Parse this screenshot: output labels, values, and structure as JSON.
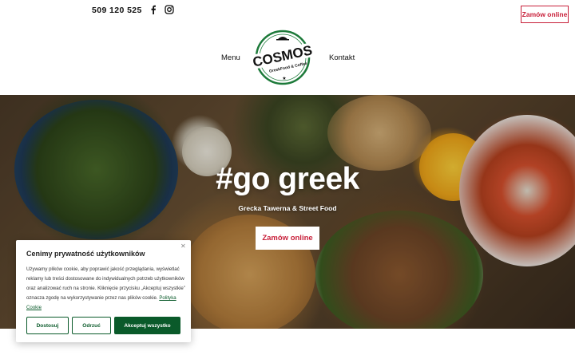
{
  "header": {
    "phone": "509 120 525",
    "order_button": "Zamów online",
    "nav": {
      "menu": "Menu",
      "kontakt": "Kontakt"
    },
    "logo": {
      "name": "COSMOS",
      "tagline": "GreekFood & Coffee"
    },
    "icons": [
      "facebook-icon",
      "instagram-icon"
    ]
  },
  "hero": {
    "title": "#go greek",
    "subtitle": "Grecka Tawerna & Street Food",
    "button": "Zamów online"
  },
  "cookie": {
    "title": "Cenimy prywatność użytkowników",
    "text": "Używamy plików cookie, aby poprawić jakość przeglądania, wyświetlać reklamy lub treści dostosowane do indywidualnych potrzeb użytkowników oraz analizować ruch na stronie. Kliknięcie przycisku „Akceptuj wszystkie” oznacza zgodę na wykorzystywanie przez nas plików cookie.",
    "link": "Polityka Cookie",
    "buttons": {
      "customize": "Dostosuj",
      "reject": "Odrzuć",
      "accept": "Akceptuj wszystko"
    }
  },
  "colors": {
    "accent": "#c8203a",
    "brand_green": "#0a5a2a"
  }
}
